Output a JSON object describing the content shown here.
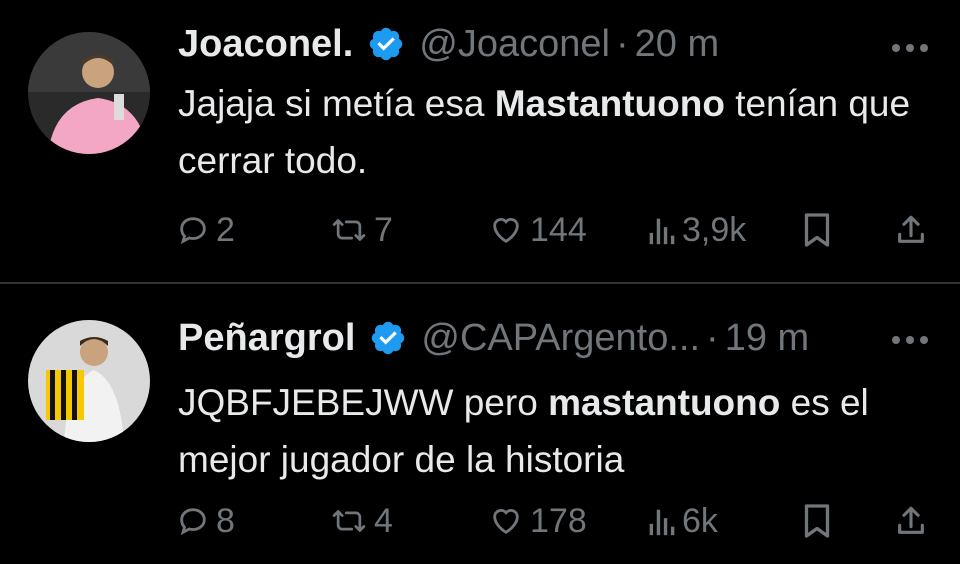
{
  "tweets": [
    {
      "name": "Joaconel.",
      "handle": "@Joaconel",
      "separator": "·",
      "time": "20 m",
      "text_parts": [
        {
          "t": "Jajaja si metía esa ",
          "bold": false
        },
        {
          "t": "Mastantuono",
          "bold": true
        },
        {
          "t": " tenían que cerrar todo.",
          "bold": false
        }
      ],
      "replies": "2",
      "retweets": "7",
      "likes": "144",
      "views": "3,9k",
      "avatar_desc": "person-pink-jersey"
    },
    {
      "name": "Peñargrol",
      "handle": "@CAPArgento...",
      "separator": "·",
      "time": "19 m",
      "text_parts": [
        {
          "t": "JQBFJEBEJWW pero ",
          "bold": false
        },
        {
          "t": "mastantuono",
          "bold": true
        },
        {
          "t": " es el mejor jugador de la historia",
          "bold": false
        }
      ],
      "replies": "8",
      "retweets": "4",
      "likes": "178",
      "views": "6k",
      "avatar_desc": "person-holding-yellow-black-jersey"
    }
  ],
  "icons": {
    "verified": "verified-badge-icon",
    "more": "more-options-icon",
    "reply": "reply-icon",
    "retweet": "retweet-icon",
    "like": "heart-icon",
    "views": "views-icon",
    "bookmark": "bookmark-icon",
    "share": "share-icon"
  },
  "colors": {
    "background": "#000000",
    "text": "#e7e9ea",
    "secondary": "#71767b",
    "verified": "#1d9bf0",
    "divider": "#2f3336"
  }
}
